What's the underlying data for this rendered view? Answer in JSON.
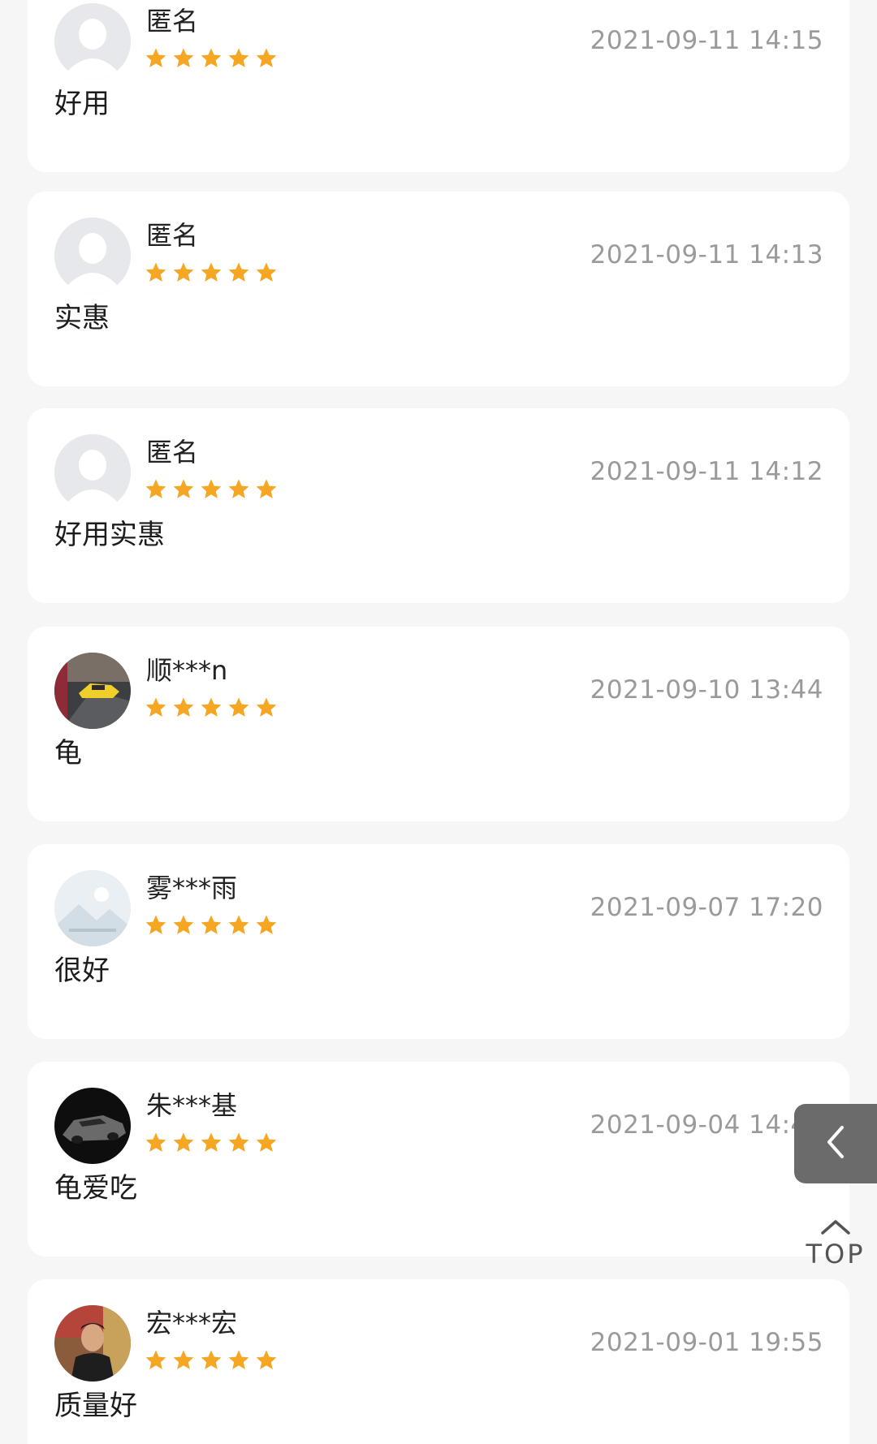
{
  "reviews": [
    {
      "avatar": "default-avatar",
      "username": "匿名",
      "rating": 5,
      "time": "2021-09-11 14:15",
      "comment": "好用"
    },
    {
      "avatar": "default-avatar",
      "username": "匿名",
      "rating": 5,
      "time": "2021-09-11 14:13",
      "comment": "实惠"
    },
    {
      "avatar": "default-avatar",
      "username": "匿名",
      "rating": 5,
      "time": "2021-09-11 14:12",
      "comment": "好用实惠"
    },
    {
      "avatar": "yellow-sports-car-photo",
      "username": "顺***n",
      "rating": 5,
      "time": "2021-09-10 13:44",
      "comment": "龟"
    },
    {
      "avatar": "image-unavailable-placeholder",
      "username": "雾***雨",
      "rating": 5,
      "time": "2021-09-07 17:20",
      "comment": "很好"
    },
    {
      "avatar": "black-sports-car-photo",
      "username": "朱***基",
      "rating": 5,
      "time": "2021-09-04 14:40",
      "comment": "龟爱吃"
    },
    {
      "avatar": "person-photo",
      "username": "宏***宏",
      "rating": 5,
      "time": "2021-09-01 19:55",
      "comment": "质量好"
    }
  ],
  "back_tab": {
    "icon": "chevron-left-icon"
  },
  "top_button": {
    "icon": "chevron-up-icon",
    "label": "TOP"
  },
  "colors": {
    "star": "#f5a623",
    "background": "#f6f6f6",
    "card": "#ffffff",
    "time_text": "#9a9a9a"
  }
}
